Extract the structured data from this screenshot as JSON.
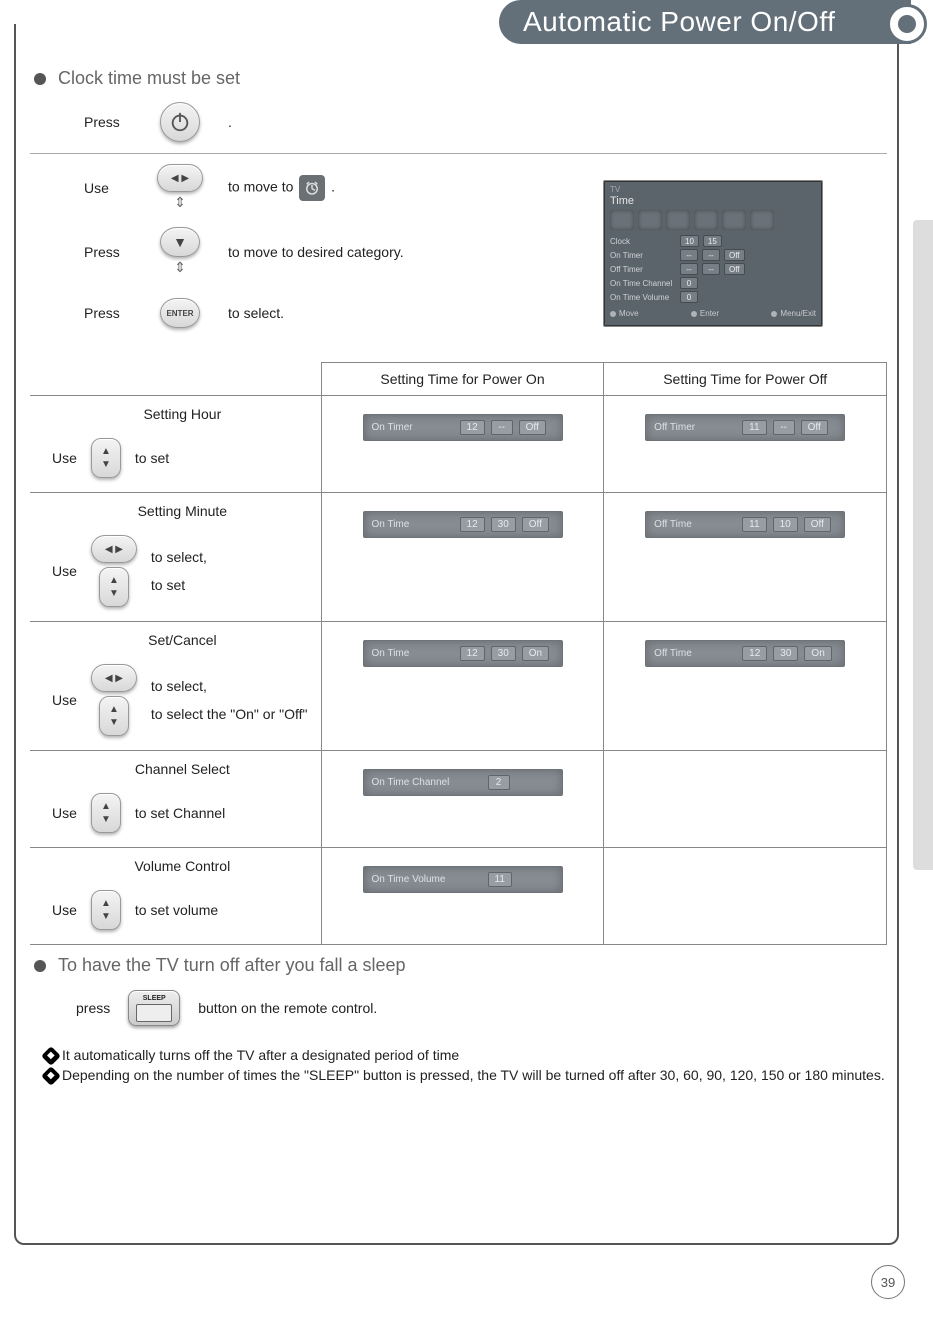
{
  "header": {
    "title": "Automatic Power On/Off"
  },
  "section1": {
    "title": "Clock time must be set",
    "rows": [
      {
        "label": "Press",
        "text_after": "."
      },
      {
        "label": "Use",
        "text_before": "to move to",
        "text_after": "."
      },
      {
        "label": "Press",
        "text": "to move to desired category."
      },
      {
        "label": "Press",
        "text": "to select."
      }
    ]
  },
  "osd": {
    "small_title": "TV",
    "title": "Time",
    "rows": {
      "clock": {
        "label": "Clock",
        "v1": "10",
        "v2": "15"
      },
      "ontimer": {
        "label": "On Timer",
        "v1": "--",
        "v2": "--",
        "v3": "Off"
      },
      "offtimer": {
        "label": "Off Timer",
        "v1": "--",
        "v2": "--",
        "v3": "Off"
      },
      "onch": {
        "label": "On Time Channel",
        "v1": "0"
      },
      "onvol": {
        "label": "On Time Volume",
        "v1": "0"
      }
    },
    "footer": {
      "move": "Move",
      "enter": "Enter",
      "exit": "Menu/Exit"
    }
  },
  "table": {
    "head": {
      "c2": "Setting Time for Power On",
      "c3": "Setting Time for Power Off"
    },
    "rows": [
      {
        "title": "Setting Hour",
        "use_label": "Use",
        "actions": [
          "to set"
        ],
        "on": {
          "label": "On Timer",
          "v1": "12",
          "v2": "--",
          "v3": "Off"
        },
        "off": {
          "label": "Off Timer",
          "v1": "11",
          "v2": "--",
          "v3": "Off"
        }
      },
      {
        "title": "Setting Minute",
        "use_label": "Use",
        "actions": [
          "to select,",
          "to set"
        ],
        "on": {
          "label": "On Time",
          "v1": "12",
          "v2": "30",
          "v3": "Off"
        },
        "off": {
          "label": "Off Time",
          "v1": "11",
          "v2": "10",
          "v3": "Off"
        }
      },
      {
        "title": "Set/Cancel",
        "use_label": "Use",
        "actions": [
          "to select,",
          "to select the \"On\" or \"Off\""
        ],
        "on": {
          "label": "On Time",
          "v1": "12",
          "v2": "30",
          "v3": "On"
        },
        "off": {
          "label": "Off Time",
          "v1": "12",
          "v2": "30",
          "v3": "On"
        }
      },
      {
        "title": "Channel Select",
        "use_label": "Use",
        "actions": [
          "to set Channel"
        ],
        "on": {
          "label": "On Time Channel",
          "v1": "2"
        },
        "off": null
      },
      {
        "title": "Volume Control",
        "use_label": "Use",
        "actions": [
          "to set volume"
        ],
        "on": {
          "label": "On Time Volume",
          "v1": "11"
        },
        "off": null
      }
    ]
  },
  "sleep": {
    "title": "To have the TV turn off after you fall a sleep",
    "press": "press",
    "after": "button on the remote control.",
    "sleep_label": "SLEEP",
    "note1": "It automatically turns off the TV after a designated period of time",
    "note2": "Depending on the number of times the \"SLEEP\" button is pressed, the TV will be turned off after 30, 60, 90, 120, 150 or 180 minutes."
  },
  "page_number": "39"
}
